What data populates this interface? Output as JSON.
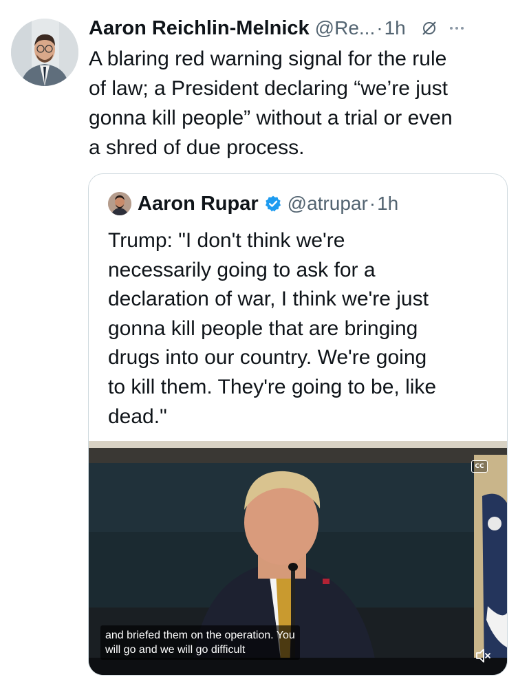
{
  "tweet": {
    "author_name": "Aaron Reichlin-Melnick",
    "author_handle": "@Re...",
    "separator": "·",
    "time": "1h",
    "text": "A blaring red warning signal for the rule\nof law; a President declaring “we’re just\ngonna kill people” without a trial or even\na shred of due process."
  },
  "quoted_tweet": {
    "author_name": "Aaron Rupar",
    "author_handle": "@atrupar",
    "separator": "·",
    "time": "1h",
    "verified": true,
    "text": "Trump: \"I don't think we're\nnecessarily going to ask for a\ndeclaration of war, I think we're just\ngonna kill people that are bringing\ndrugs into our country. We're going\nto kill them. They're going to be, like\ndead.\""
  },
  "video": {
    "cc_label": "CC",
    "caption": "and briefed them on the operation. You\nwill go and we will go difficult",
    "muted": true
  },
  "icons": {
    "grok": "grok-icon",
    "more": "more-icon",
    "verified": "verified-badge-icon",
    "mute": "speaker-muted-icon"
  },
  "colors": {
    "text": "#0f1419",
    "secondary": "#536471",
    "verified": "#1d9bf0",
    "border": "#cfd9de"
  }
}
